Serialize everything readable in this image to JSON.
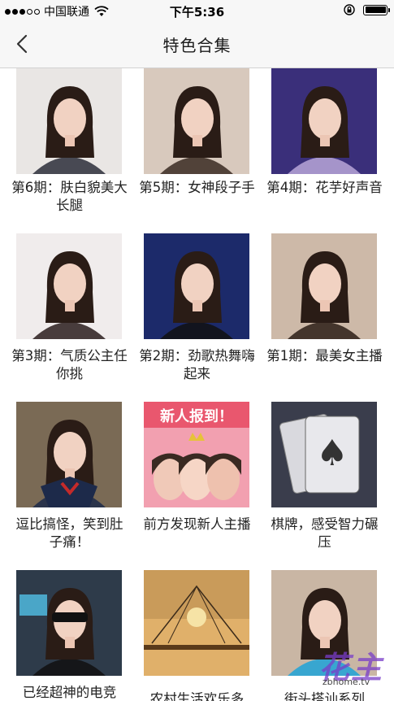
{
  "status_bar": {
    "carrier": "中国联通",
    "time": "下午5:36"
  },
  "nav": {
    "title": "特色合集"
  },
  "cards": [
    {
      "title": "第6期：肤白貌美大长腿"
    },
    {
      "title": "第5期：女神段子手"
    },
    {
      "title": "第4期：花芋好声音"
    },
    {
      "title": "第3期：气质公主任你挑"
    },
    {
      "title": "第2期：劲歌热舞嗨起来"
    },
    {
      "title": "第1期：最美女主播"
    },
    {
      "title": "逗比搞怪，笑到肚子痛！"
    },
    {
      "title": "前方发现新人主播"
    },
    {
      "title": "棋牌，感受智力碾压"
    },
    {
      "title": "已经超神的电竞"
    },
    {
      "title": "农村生活欢乐多"
    },
    {
      "title": "街头搭讪系列"
    }
  ],
  "thumbnails": [
    {
      "bg": "#e9e6e4",
      "accent": "#2b2d3a"
    },
    {
      "bg": "#d8c9bd",
      "accent": "#3a2a22"
    },
    {
      "bg": "#3a2f7a",
      "accent": "#b9a6d8"
    },
    {
      "bg": "#f0ecec",
      "accent": "#2a1d1d"
    },
    {
      "bg": "#1c2a6a",
      "accent": "#111111"
    },
    {
      "bg": "#cdb9a8",
      "accent": "#2b1d16"
    },
    {
      "bg": "#7a6a55",
      "accent": "#1d2a4a"
    },
    {
      "bg": "#f2a0b0",
      "accent": "#e6c23a"
    },
    {
      "bg": "#3a3d4c",
      "accent": "#e8e8ec"
    },
    {
      "bg": "#2e3b4a",
      "accent": "#111111"
    },
    {
      "bg": "#c99b5a",
      "accent": "#3a2a1a"
    },
    {
      "bg": "#c9b6a4",
      "accent": "#1fa3d8"
    }
  ],
  "thumb_texts": {
    "new_streamer_banner": "新人报到！"
  },
  "watermark": {
    "mark": "花主",
    "url": "zbhome.tv"
  }
}
